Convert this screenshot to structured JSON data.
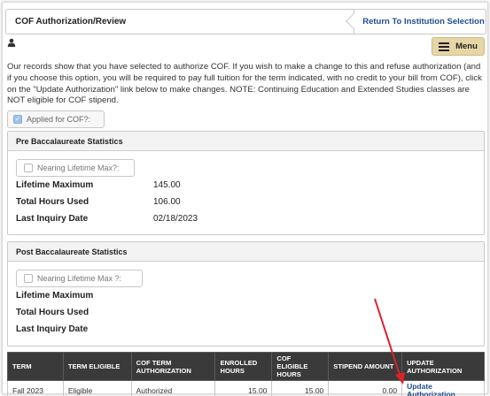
{
  "header": {
    "title": "COF Authorization/Review",
    "return_label": "Return To Institution Selection",
    "menu_label": "Menu",
    "user_icon": "user-icon"
  },
  "notice": {
    "text": "Our records show that you have selected to authorize COF. If you wish to make a change to this and refuse authorization (and if you choose this option, you will be required to pay full tuition for the term indicated, with no credit to your bill from COF), click on the \"Update Authorization\" link below to make changes. NOTE: Continuing Education and Extended Studies classes are NOT eligible for COF stipend."
  },
  "applied": {
    "label": "Applied for COF?:",
    "checked": true
  },
  "pre_bacc": {
    "title": "Pre Baccalaureate Statistics",
    "nearing_label": "Nearing Lifetime Max?:",
    "rows": [
      {
        "label": "Lifetime Maximum",
        "value": "145.00"
      },
      {
        "label": "Total Hours Used",
        "value": "106.00"
      },
      {
        "label": "Last Inquiry Date",
        "value": "02/18/2023"
      }
    ]
  },
  "post_bacc": {
    "title": "Post Baccalaureate Statistics",
    "nearing_label": "Nearing Lifetime Max ?:",
    "rows": [
      {
        "label": "Lifetime Maximum",
        "value": ""
      },
      {
        "label": "Total Hours Used",
        "value": ""
      },
      {
        "label": "Last Inquiry Date",
        "value": ""
      }
    ]
  },
  "term_table": {
    "headers": [
      "TERM",
      "TERM ELIGIBLE",
      "COF TERM AUTHORIZATION",
      "ENROLLED HOURS",
      "COF ELIGIBLE HOURS",
      "STIPEND AMOUNT",
      "UPDATE AUTHORIZATION"
    ],
    "rows": [
      {
        "term": "Fall 2023",
        "eligible": "Eligible",
        "authorization": "Authorized",
        "enrolled": "15.00",
        "cof_hours": "15.00",
        "stipend": "0.00",
        "update_link": "Update Authorization"
      }
    ]
  },
  "colors": {
    "menu_bg": "#e6d6a6",
    "link": "#1f4e8c",
    "table_header": "#3a3a3a",
    "arrow": "#d8232a"
  }
}
